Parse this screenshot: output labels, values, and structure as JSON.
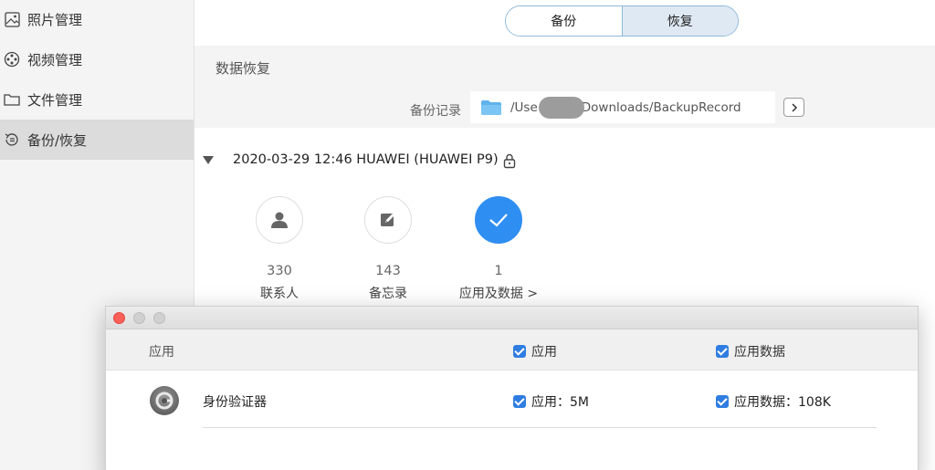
{
  "sidebar": {
    "items": [
      {
        "label": "照片管理",
        "icon": "photo-icon"
      },
      {
        "label": "视频管理",
        "icon": "film-reel-icon"
      },
      {
        "label": "文件管理",
        "icon": "folder-icon"
      },
      {
        "label": "备份/恢复",
        "icon": "restore-icon"
      }
    ]
  },
  "segment": {
    "backup": "备份",
    "restore": "恢复"
  },
  "section": {
    "title": "数据恢复",
    "record_label": "备份记录",
    "path_prefix": "/Use",
    "path_suffix": "Downloads/BackupRecord"
  },
  "backup": {
    "title": "2020-03-29 12:46 HUAWEI  (HUAWEI P9)"
  },
  "categories": [
    {
      "count": "330",
      "label": "联系人",
      "icon": "person-icon"
    },
    {
      "count": "143",
      "label": "备忘录",
      "icon": "note-edit-icon"
    },
    {
      "count": "1",
      "label": "应用及数据 >",
      "icon": "check-icon"
    }
  ],
  "dialog": {
    "header": {
      "col0": "应用",
      "col1": "应用",
      "col2": "应用数据"
    },
    "rows": [
      {
        "name": "身份验证器",
        "app": "应用：5M",
        "data": "应用数据：108K"
      }
    ]
  },
  "colors": {
    "accent": "#2f8ef1",
    "checkbox": "#2f7de1",
    "close": "#fc5f57"
  }
}
